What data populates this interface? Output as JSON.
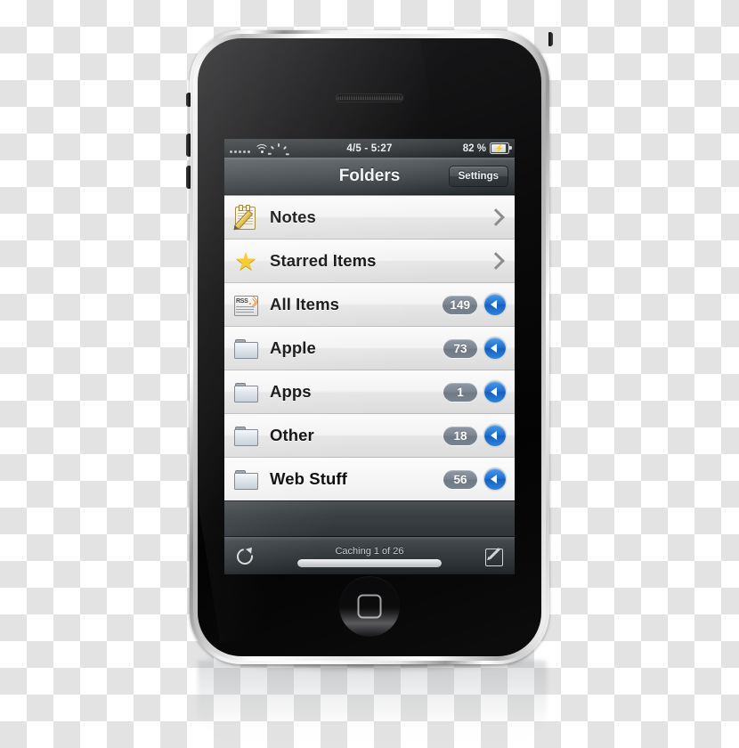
{
  "device": {
    "name": "iPhone 3G",
    "home_button": "home-button",
    "earpiece": "earpiece-speaker"
  },
  "status_bar": {
    "signal_icon": "signal-dots-icon",
    "wifi_icon": "wifi-icon",
    "activity_icon": "activity-spinner-icon",
    "center_text": "4/5 - 5:27",
    "battery_percent": "82 %",
    "battery_icon": "battery-charging-icon",
    "battery_fill_percent": 82
  },
  "nav_bar": {
    "title": "Folders",
    "settings_label": "Settings"
  },
  "list": {
    "rows": [
      {
        "label": "Notes",
        "icon": "notepad-pencil-icon",
        "icon_class": "ic-notes",
        "accessory": "chevron",
        "badge": null
      },
      {
        "label": "Starred Items",
        "icon": "star-icon",
        "icon_class": "ic-star",
        "accessory": "chevron",
        "badge": null
      },
      {
        "label": "All Items",
        "icon": "rss-newspaper-icon",
        "icon_class": "ic-rss",
        "accessory": "disclosure",
        "badge": "149"
      },
      {
        "label": "Apple",
        "icon": "folder-icon",
        "icon_class": "ic-folder",
        "accessory": "disclosure",
        "badge": "73"
      },
      {
        "label": "Apps",
        "icon": "folder-icon",
        "icon_class": "ic-folder",
        "accessory": "disclosure",
        "badge": "1"
      },
      {
        "label": "Other",
        "icon": "folder-icon",
        "icon_class": "ic-folder",
        "accessory": "disclosure",
        "badge": "18"
      },
      {
        "label": "Web Stuff",
        "icon": "folder-icon",
        "icon_class": "ic-folder",
        "accessory": "disclosure",
        "badge": "56"
      }
    ]
  },
  "toolbar": {
    "refresh_icon": "refresh-icon",
    "status_text": "Caching 1 of 26",
    "progress_percent": 100,
    "compose_icon": "compose-icon"
  },
  "colors": {
    "badge": "#7c8693",
    "disclosure_blue": "#1e6fd0",
    "nav_bar": "#3e4347",
    "list_row": "#f3f3f3",
    "screen_bg": "#2e3134",
    "rss_orange": "#e07820",
    "star_yellow": "#f5c518"
  }
}
